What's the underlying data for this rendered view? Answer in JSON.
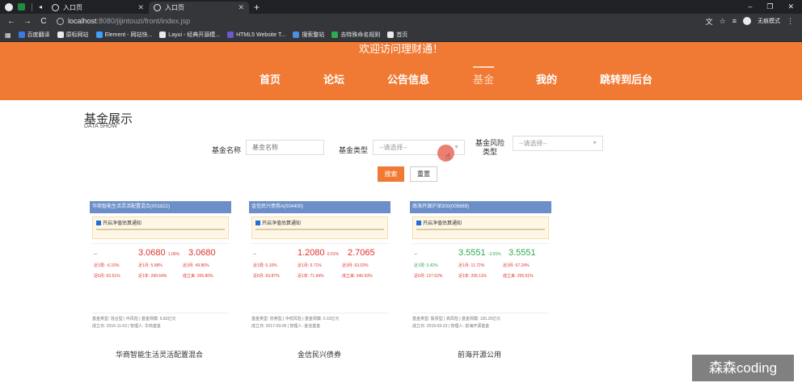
{
  "browser": {
    "tabs": [
      {
        "label": "入口页"
      },
      {
        "label": "入口页"
      }
    ],
    "url_host": "localhost",
    "url_path": ":8080/jijintouzi/front/index.jsp",
    "profile_label": "无痕模式",
    "bookmarks": [
      {
        "label": "百度翻译",
        "color": "#3a7be0"
      },
      {
        "label": "原标网站",
        "color": "#e8eaed"
      },
      {
        "label": "Element - 网站快...",
        "color": "#409eff"
      },
      {
        "label": "Layui - 经典开源模...",
        "color": "#e8eaed"
      },
      {
        "label": "HTML5 Website T...",
        "color": "#6a5acd"
      },
      {
        "label": "搜索整站",
        "color": "#4a90e2"
      },
      {
        "label": "去特殊命名规则",
        "color": "#2eaa4f"
      },
      {
        "label": "首页",
        "color": "#e8eaed"
      }
    ]
  },
  "header": {
    "welcome": "欢迎访问理财通！",
    "nav": [
      {
        "label": "首页",
        "active": false
      },
      {
        "label": "论坛",
        "active": false
      },
      {
        "label": "公告信息",
        "active": false
      },
      {
        "label": "基金",
        "active": true
      },
      {
        "label": "我的",
        "active": false
      },
      {
        "label": "跳转到后台",
        "active": false
      }
    ],
    "accent_color": "#f07a34"
  },
  "section": {
    "title": "基金展示",
    "subtitle": "DATA SHOW"
  },
  "filters": {
    "name_label": "基金名称",
    "name_placeholder": "基金名称",
    "type_label": "基金类型",
    "type_value": "--请选择--",
    "risk_label": "基金风险类型",
    "risk_value": "--请选择--",
    "search_button": "搜索",
    "reset_button": "重置"
  },
  "cards": [
    {
      "header": "华商智能生活灵活配置混合(001822)",
      "warn": "开启净值估算通知",
      "nav_price": "3.0680",
      "nav_pct": "1.06%",
      "acc_price": "3.0680",
      "trend": "red",
      "r1": "近1周: -6.15%",
      "r2": "近1月: 5.68%",
      "r3": "近3月: 49.86%",
      "r4": "近6月: 62.51%",
      "r5": "近1年: 290.64%",
      "r6": "成立来: 206.80%",
      "foot1": "基金类型: 混合型 | 中风险 | 基金规模: 6.83亿元",
      "foot2": "成立日: 2016-11-03 | 管理人: 华商基金",
      "name": "华商智能生活灵活配置混合"
    },
    {
      "header": "金信民兴债券A(004400)",
      "warn": "开启净值估算通知",
      "nav_price": "1.2080",
      "nav_pct": "0.01%",
      "acc_price": "2.7065",
      "trend": "red",
      "r1": "近1周: 0.10%",
      "r2": "近1月: 0.71%",
      "r3": "近3月: 63.03%",
      "r4": "近6月: 63.87%",
      "r5": "近1年: 71.94%",
      "r6": "成立来: 240.93%",
      "foot1": "基金类型: 债券型 | 中低风险 | 基金规模: 0.10亿元",
      "foot2": "成立日: 2017-03-06 | 管理人: 金信基金",
      "name": "金信民兴债券"
    },
    {
      "header": "南海开源沪深300(005669)",
      "warn": "开启净值估算通知",
      "nav_price": "3.5551",
      "nav_pct": "-3.55%",
      "acc_price": "3.5551",
      "trend": "green",
      "r1": "近1周: 3.42%",
      "r2": "近1月: 11.72%",
      "r3": "近3月: 67.24%",
      "r4": "近6月: 127.62%",
      "r5": "近1年: 205.11%",
      "r6": "成立来: 255.51%",
      "foot1": "基金类型: 股票型 | 高风险 | 基金规模: 105.29亿元",
      "foot2": "成立日: 2018-03-23 | 管理人: 前海开源基金",
      "name": "前海开源公用"
    }
  ],
  "watermark": "森森coding"
}
